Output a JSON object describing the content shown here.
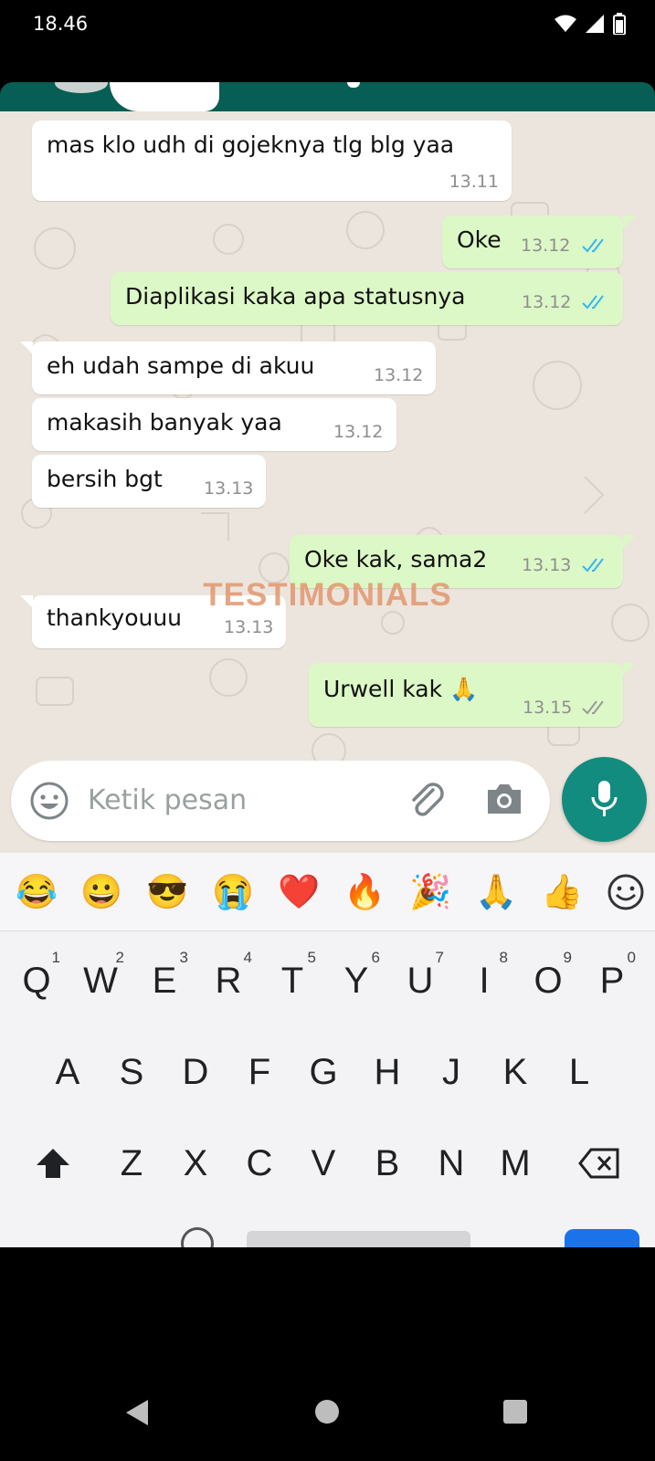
{
  "status_bar": {
    "time": "18.46"
  },
  "messages": [
    {
      "dir": "in",
      "text": "mas klo udh di gojeknya tlg blg yaa",
      "time": "13.11"
    },
    {
      "dir": "out",
      "text": "Oke",
      "time": "13.12",
      "ticks": "read"
    },
    {
      "dir": "out",
      "text": "Diaplikasi kaka apa statusnya",
      "time": "13.12",
      "ticks": "read"
    },
    {
      "dir": "in",
      "text": "eh udah sampe di akuu",
      "time": "13.12"
    },
    {
      "dir": "in",
      "text": "makasih banyak yaa",
      "time": "13.12"
    },
    {
      "dir": "in",
      "text": "bersih bgt",
      "time": "13.13"
    },
    {
      "dir": "out",
      "text": "Oke kak, sama2",
      "time": "13.13",
      "ticks": "read"
    },
    {
      "dir": "in",
      "text": "thankyouuu",
      "time": "13.13"
    },
    {
      "dir": "out",
      "text": "Urwell kak 🙏",
      "time": "13.15",
      "ticks": "delivered"
    }
  ],
  "watermark": "TESTIMONIALS",
  "composer": {
    "placeholder": "Ketik pesan"
  },
  "emoji_suggestions": [
    "😂",
    "😀",
    "😎",
    "😭",
    "❤️",
    "🔥",
    "🎉",
    "🙏",
    "👍"
  ],
  "keyboard": {
    "row1": [
      {
        "key": "Q",
        "sup": "1"
      },
      {
        "key": "W",
        "sup": "2"
      },
      {
        "key": "E",
        "sup": "3"
      },
      {
        "key": "R",
        "sup": "4"
      },
      {
        "key": "T",
        "sup": "5"
      },
      {
        "key": "Y",
        "sup": "6"
      },
      {
        "key": "U",
        "sup": "7"
      },
      {
        "key": "I",
        "sup": "8"
      },
      {
        "key": "O",
        "sup": "9"
      },
      {
        "key": "P",
        "sup": "0"
      }
    ],
    "row2": [
      "A",
      "S",
      "D",
      "F",
      "G",
      "H",
      "J",
      "K",
      "L"
    ],
    "row3": [
      "Z",
      "X",
      "C",
      "V",
      "B",
      "N",
      "M"
    ]
  },
  "colors": {
    "header": "#075e54",
    "chat_bg": "#ece5dd",
    "incoming": "#ffffff",
    "outgoing": "#dcf8c6",
    "tick_read": "#34b7f1",
    "tick_delivered": "#9a9a9a",
    "mic": "#128c7e"
  },
  "icons": {
    "status": [
      "wifi-icon",
      "signal-icon",
      "battery-icon"
    ],
    "composer": [
      "emoji-icon",
      "attach-icon",
      "camera-icon",
      "mic-icon"
    ],
    "nav": [
      "back-icon",
      "home-icon",
      "recents-icon"
    ]
  }
}
